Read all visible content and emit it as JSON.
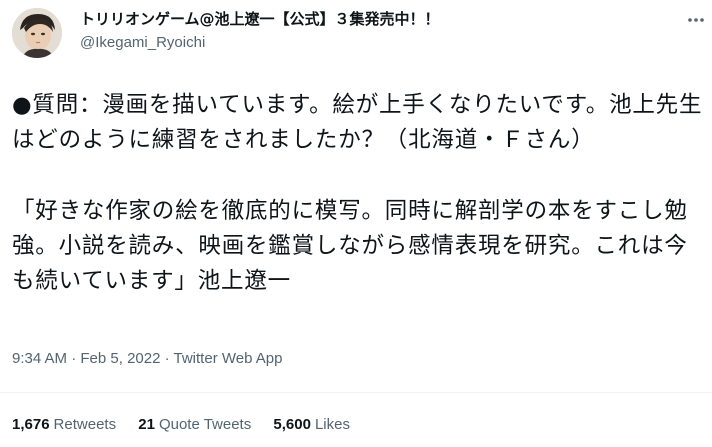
{
  "author": {
    "display_name": "トリリオンゲーム@池上遼一【公式】３集発売中！！",
    "handle": "@Ikegami_Ryoichi"
  },
  "icons": {
    "avatar": "avatar-portrait",
    "more": "more-horizontal-icon"
  },
  "tweet": {
    "paragraph1": "●質問：漫画を描いています。絵が上手くなりたいです。池上先生はどのように練習をされましたか？（北海道・Ｆさん）",
    "paragraph2": "「好きな作家の絵を徹底的に模写。同時に解剖学の本をすこし勉強。小説を読み、映画を鑑賞しながら感情表現を研究。これは今も続いています」池上遼一"
  },
  "meta": {
    "time": "9:34 AM",
    "separator1": " · ",
    "date": "Feb 5, 2022",
    "separator2": " · ",
    "source": "Twitter Web App"
  },
  "stats": {
    "retweets_count": "1,676",
    "retweets_label": "Retweets",
    "quotes_count": "21",
    "quotes_label": "Quote Tweets",
    "likes_count": "5,600",
    "likes_label": "Likes"
  },
  "colors": {
    "text_primary": "#0f1419",
    "text_secondary": "#536471",
    "divider": "#eff3f4"
  }
}
